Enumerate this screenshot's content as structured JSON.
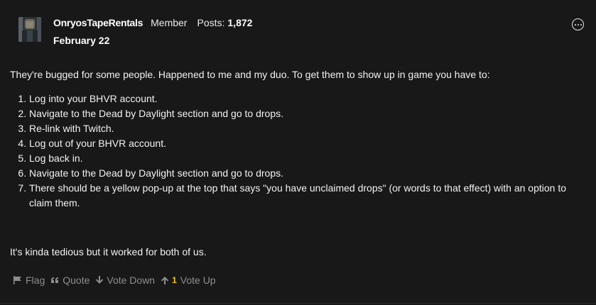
{
  "post": {
    "username": "OnryosTapeRentals",
    "role": "Member",
    "posts_label": "Posts:",
    "posts_count": "1,872",
    "date": "February 22",
    "intro": "They're bugged for some people. Happened to me and my duo. To get them to show up in game you have to:",
    "steps": [
      "Log into your BHVR account.",
      "Navigate to the Dead by Daylight section and go to drops.",
      "Re-link with Twitch.",
      "Log out of your BHVR account.",
      "Log back in.",
      "Navigate to the Dead by Daylight section and go to drops.",
      "There should be a yellow pop-up at the top that says \"you have unclaimed drops\" (or words to that effect) with an option to claim them."
    ],
    "closing": "It's kinda tedious but it worked for both of us."
  },
  "actions": {
    "flag": "Flag",
    "quote": "Quote",
    "vote_down": "Vote Down",
    "vote_count": "1",
    "vote_up": "Vote Up"
  },
  "icons": {
    "options": "ellipsis-circle-icon",
    "flag": "flag-icon",
    "quote": "quote-icon",
    "vote_down": "arrow-down-icon",
    "vote_up": "arrow-up-icon"
  },
  "colors": {
    "background": "#181818",
    "text": "#f2f2f2",
    "muted": "#8e8e8e",
    "vote_count": "#f5c400"
  }
}
